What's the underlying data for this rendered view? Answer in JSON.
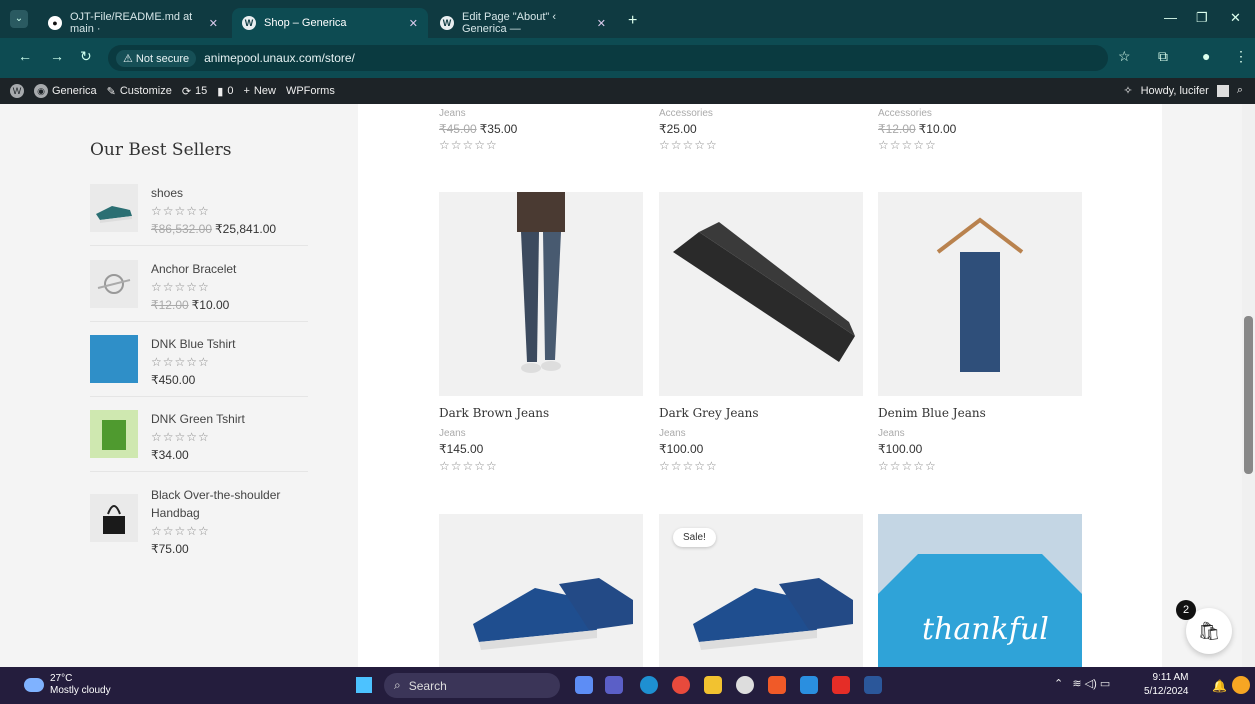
{
  "browser": {
    "tabs": [
      {
        "title": "OJT-File/README.md at main ·",
        "icon": "github-icon"
      },
      {
        "title": "Shop – Generica",
        "icon": "wordpress-icon"
      },
      {
        "title": "Edit Page \"About\" ‹ Generica —",
        "icon": "wordpress-icon"
      }
    ],
    "not_secure": "Not secure",
    "url": "animepool.unaux.com/store/"
  },
  "adminbar": {
    "site": "Generica",
    "customize": "Customize",
    "updates": "15",
    "comments": "0",
    "new": "New",
    "wpforms": "WPForms",
    "howdy": "Howdy, lucifer"
  },
  "sidebar": {
    "title": "Our Best Sellers",
    "items": [
      {
        "name": "shoes",
        "old": "₹86,532.00",
        "price": "₹25,841.00",
        "stars": "☆☆☆☆☆"
      },
      {
        "name": "Anchor Bracelet",
        "old": "₹12.00",
        "price": "₹10.00",
        "stars": "☆☆☆☆☆"
      },
      {
        "name": "DNK Blue Tshirt",
        "old": "",
        "price": "₹450.00",
        "stars": "☆☆☆☆☆"
      },
      {
        "name": "DNK Green Tshirt",
        "old": "",
        "price": "₹34.00",
        "stars": "☆☆☆☆☆"
      },
      {
        "name": "Black Over-the-shoulder Handbag",
        "old": "",
        "price": "₹75.00",
        "stars": "☆☆☆☆☆"
      }
    ]
  },
  "top_row": [
    {
      "category": "Jeans",
      "old": "₹45.00",
      "price": "₹35.00",
      "stars": "☆☆☆☆☆"
    },
    {
      "category": "Accessories",
      "old": "",
      "price": "₹25.00",
      "stars": "☆☆☆☆☆"
    },
    {
      "category": "Accessories",
      "old": "₹12.00",
      "price": "₹10.00",
      "stars": "☆☆☆☆☆"
    }
  ],
  "products": [
    {
      "name": "Dark Brown Jeans",
      "category": "Jeans",
      "price": "₹145.00",
      "stars": "☆☆☆☆☆"
    },
    {
      "name": "Dark Grey Jeans",
      "category": "Jeans",
      "price": "₹100.00",
      "stars": "☆☆☆☆☆"
    },
    {
      "name": "Denim Blue Jeans",
      "category": "Jeans",
      "price": "₹100.00",
      "stars": "☆☆☆☆☆"
    }
  ],
  "bottom_row": {
    "sale_badge": "Sale!",
    "tshirt_text": "thankful"
  },
  "cart": {
    "count": "2"
  },
  "taskbar": {
    "temp": "27°C",
    "weather": "Mostly cloudy",
    "search": "Search",
    "time": "9:11 AM",
    "date": "5/12/2024"
  }
}
